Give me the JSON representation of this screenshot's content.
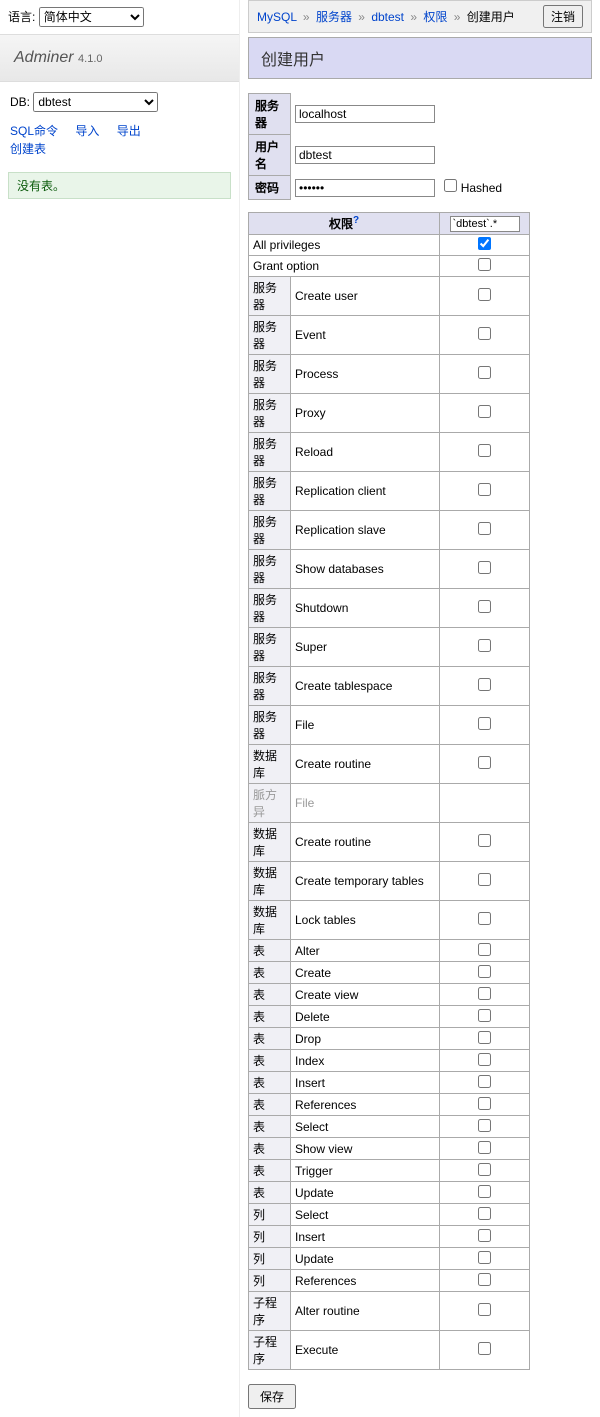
{
  "language": {
    "label": "语言:",
    "selected": "简体中文"
  },
  "logo": {
    "name": "Adminer",
    "version": "4.1.0"
  },
  "db": {
    "label": "DB:",
    "selected": "dbtest"
  },
  "sidebar_links": {
    "sql": "SQL命令",
    "import": "导入",
    "export": "导出",
    "create_table": "创建表"
  },
  "no_tables": "没有表。",
  "breadcrumb": {
    "mysql": "MySQL",
    "server": "服务器",
    "db": "dbtest",
    "priv": "权限",
    "current": "创建用户"
  },
  "logout": "注销",
  "page_title": "创建用户",
  "form": {
    "server_label": "服务器",
    "server_value": "localhost",
    "user_label": "用户名",
    "user_value": "dbtest",
    "pass_label": "密码",
    "pass_value": "••••••",
    "hashed": "Hashed"
  },
  "priv_header": {
    "label": "权限",
    "help": "?",
    "scope": "`dbtest`.*"
  },
  "privileges": [
    {
      "cat": "",
      "name": "All privileges",
      "checked": true,
      "span": true
    },
    {
      "cat": "",
      "name": "Grant option",
      "checked": false,
      "span": true
    },
    {
      "cat": "服务器",
      "name": "Create user",
      "checked": false
    },
    {
      "cat": "服务器",
      "name": "Event",
      "checked": false
    },
    {
      "cat": "服务器",
      "name": "Process",
      "checked": false
    },
    {
      "cat": "服务器",
      "name": "Proxy",
      "checked": false
    },
    {
      "cat": "服务器",
      "name": "Reload",
      "checked": false
    },
    {
      "cat": "服务器",
      "name": "Replication client",
      "checked": false
    },
    {
      "cat": "服务器",
      "name": "Replication slave",
      "checked": false
    },
    {
      "cat": "服务器",
      "name": "Show databases",
      "checked": false
    },
    {
      "cat": "服务器",
      "name": "Shutdown",
      "checked": false
    },
    {
      "cat": "服务器",
      "name": "Super",
      "checked": false
    },
    {
      "cat": "服务器",
      "name": "Create tablespace",
      "checked": false
    },
    {
      "cat": "服务器",
      "name": "File",
      "checked": false
    },
    {
      "cat": "数据库",
      "name": "Create routine",
      "checked": false
    },
    {
      "cat": "数据库",
      "name": "Create routine",
      "checked": false
    },
    {
      "cat": "数据库",
      "name": "Create temporary tables",
      "checked": false
    },
    {
      "cat": "数据库",
      "name": "Lock tables",
      "checked": false
    },
    {
      "cat": "表",
      "name": "Alter",
      "checked": false
    },
    {
      "cat": "表",
      "name": "Create",
      "checked": false
    },
    {
      "cat": "表",
      "name": "Create view",
      "checked": false
    },
    {
      "cat": "表",
      "name": "Delete",
      "checked": false
    },
    {
      "cat": "表",
      "name": "Drop",
      "checked": false
    },
    {
      "cat": "表",
      "name": "Index",
      "checked": false
    },
    {
      "cat": "表",
      "name": "Insert",
      "checked": false
    },
    {
      "cat": "表",
      "name": "References",
      "checked": false
    },
    {
      "cat": "表",
      "name": "Select",
      "checked": false
    },
    {
      "cat": "表",
      "name": "Show view",
      "checked": false
    },
    {
      "cat": "表",
      "name": "Trigger",
      "checked": false
    },
    {
      "cat": "表",
      "name": "Update",
      "checked": false
    },
    {
      "cat": "列",
      "name": "Select",
      "checked": false
    },
    {
      "cat": "列",
      "name": "Insert",
      "checked": false
    },
    {
      "cat": "列",
      "name": "Update",
      "checked": false
    },
    {
      "cat": "列",
      "name": "References",
      "checked": false
    },
    {
      "cat": "子程序",
      "name": "Alter routine",
      "checked": false
    },
    {
      "cat": "子程序",
      "name": "Execute",
      "checked": false
    }
  ],
  "truncated_row": {
    "cat": "脈方异",
    "name": "File"
  },
  "save": "保存"
}
